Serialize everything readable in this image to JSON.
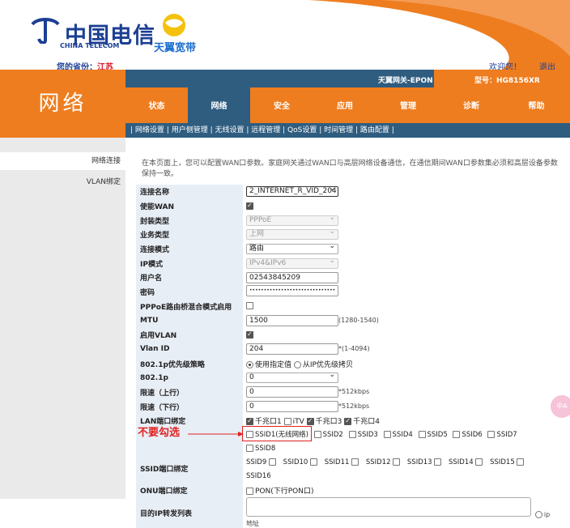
{
  "header": {
    "brand_cn": "中国电信",
    "brand_en": "CHINA TELECOM",
    "tianyi": "天翼宽带",
    "province_label": "您的省份：",
    "province": "江苏",
    "welcome": "欢迎您！",
    "logout": "退出"
  },
  "info": {
    "gateway": "天翼网关-EPON",
    "model": "型号：HG8156XR"
  },
  "page_title": "网络",
  "tabs": [
    "状态",
    "网络",
    "安全",
    "应用",
    "管理",
    "诊断",
    "帮助"
  ],
  "subnav": [
    "网络设置",
    "用户侧管理",
    "无线设置",
    "远程管理",
    "QoS设置",
    "时间管理",
    "路由配置"
  ],
  "sidebar": [
    "网络连接",
    "VLAN绑定"
  ],
  "intro": "在本页面上，您可以配置WAN口参数。家庭网关通过WAN口与高层网络设备通信，在通信期间WAN口参数集必须和高层设备参数保持一致。",
  "form": {
    "conn_name_label": "连接名称",
    "conn_name": "2_INTERNET_R_VID_204",
    "enable_wan_label": "使能WAN",
    "encap_label": "封装类型",
    "encap": "PPPoE",
    "service_label": "业务类型",
    "service": "上网",
    "mode_label": "连接模式",
    "mode": "路由",
    "ip_label": "IP模式",
    "ip": "IPv4&IPv6",
    "user_label": "用户名",
    "user": "02543845209",
    "pwd_label": "密码",
    "pwd": "••••••••••••••••••••••••••••••",
    "pppoe_label": "PPPoE路由桥混合模式启用",
    "mtu_label": "MTU",
    "mtu": "1500",
    "mtu_hint": "(1280-1540)",
    "vlan_en_label": "启用VLAN",
    "vlan_label": "Vlan ID",
    "vlan": "204",
    "vlan_hint": "*(1-4094)",
    "p8021_pol_label": "802.1p优先级策略",
    "p8021_opt1": "使用指定值",
    "p8021_opt2": "从IP优先级拷贝",
    "p8021_label": "802.1p",
    "p8021": "0",
    "up_label": "限速（上行）",
    "up": "0",
    "up_hint": "*512kbps",
    "down_label": "限速（下行）",
    "down": "0",
    "down_hint": "*512kbps",
    "lan_label": "LAN端口绑定",
    "lan": [
      "千兆口1",
      "iTV",
      "千兆口3",
      "千兆口4"
    ],
    "ssid_label": "SSID端口绑定",
    "ssid_row1": [
      "SSID1(无线网络)",
      "SSID2",
      "SSID3",
      "SSID4",
      "SSID5",
      "SSID6",
      "SSID7",
      "SSID8"
    ],
    "ssid_row2": [
      "SSID9",
      "SSID10",
      "SSID11",
      "SSID12",
      "SSID13",
      "SSID14",
      "SSID15",
      "SSID16"
    ],
    "onu_label": "ONU端口绑定",
    "onu": "PON(下行PON口)",
    "fwd_label": "目的IP转发列表",
    "fwd_hint": "ip地址"
  },
  "annotation": "不要勾选",
  "float_label": "中A"
}
